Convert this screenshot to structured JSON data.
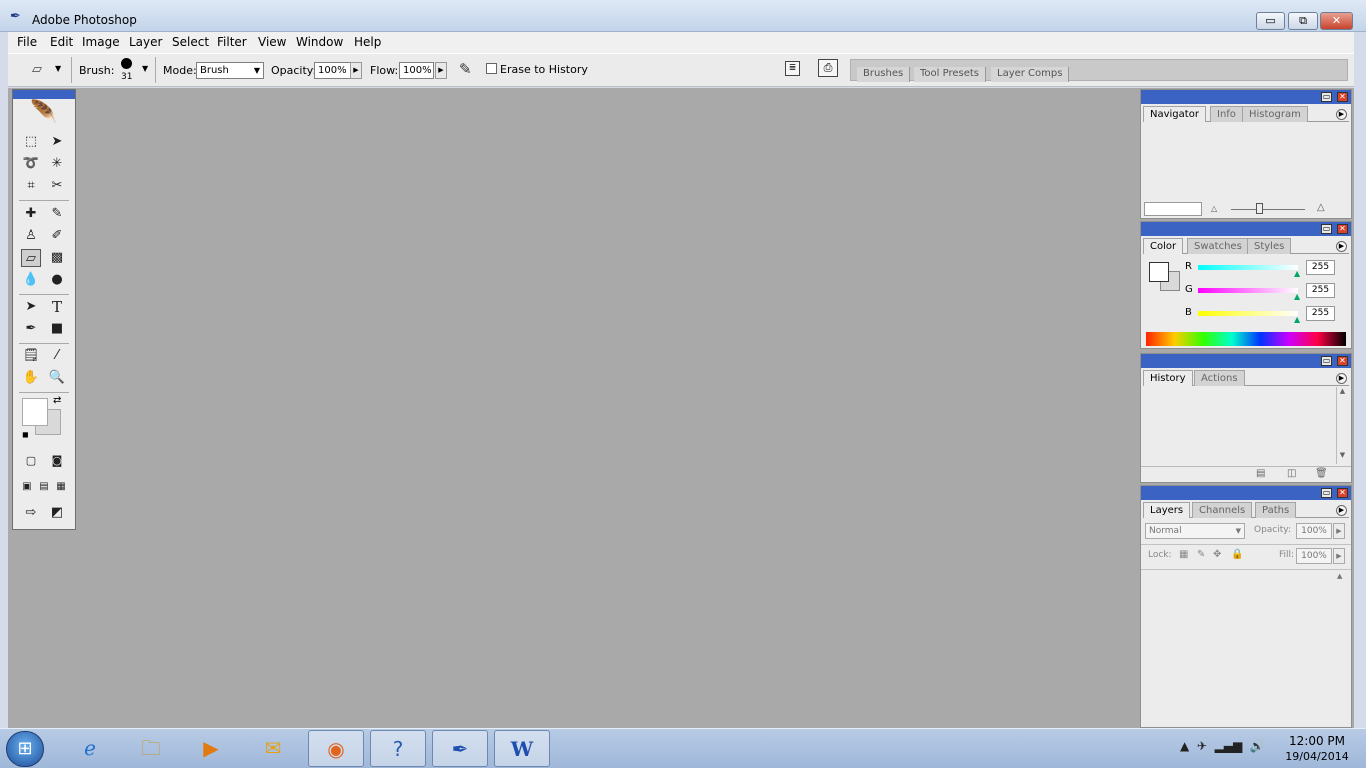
{
  "window": {
    "title": "Adobe Photoshop",
    "min_symbol": "▭",
    "max_symbol": "⧉",
    "close_symbol": "✕"
  },
  "menu": [
    "File",
    "Edit",
    "Image",
    "Layer",
    "Select",
    "Filter",
    "View",
    "Window",
    "Help"
  ],
  "options": {
    "brush_label": "Brush:",
    "brush_size": "31",
    "mode_label": "Mode:",
    "mode_value": "Brush",
    "opacity_label": "Opacity:",
    "opacity_value": "100%",
    "flow_label": "Flow:",
    "flow_value": "100%",
    "erase_to_history": "Erase to History",
    "palette_well_tabs": [
      "Brushes",
      "Tool Presets",
      "Layer Comps"
    ]
  },
  "palettes": {
    "navigator": {
      "tabs": [
        "Navigator",
        "Info",
        "Histogram"
      ]
    },
    "color": {
      "tabs": [
        "Color",
        "Swatches",
        "Styles"
      ],
      "r_label": "R",
      "r_value": "255",
      "g_label": "G",
      "g_value": "255",
      "b_label": "B",
      "b_value": "255",
      "foreground": "#ffffff",
      "background": "#d9d9d9"
    },
    "history": {
      "tabs": [
        "History",
        "Actions"
      ]
    },
    "layers": {
      "tabs": [
        "Layers",
        "Channels",
        "Paths"
      ],
      "blend_mode": "Normal",
      "opacity_label": "Opacity:",
      "opacity_value": "100%",
      "lock_label": "Lock:",
      "fill_label": "Fill:",
      "fill_value": "100%"
    }
  },
  "taskbar": {
    "time": "12:00 PM",
    "date": "19/04/2014",
    "apps": [
      "internet-explorer",
      "file-explorer",
      "media-player",
      "outlook",
      "firefox",
      "help",
      "photoshop",
      "word"
    ]
  },
  "colors": {
    "workspace": "#a9a9a9",
    "palette_header": "#3b63c4"
  }
}
